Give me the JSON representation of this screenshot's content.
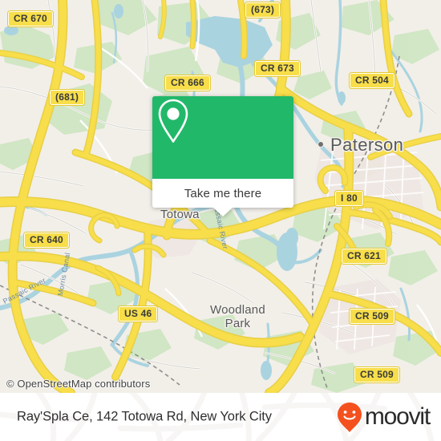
{
  "map": {
    "provider_attribution": "© OpenStreetMap contributors",
    "base_color": "#f2efe9",
    "road_color": "#f7de4a",
    "water_color": "#aad3e0",
    "park_color": "#cfe3bd",
    "city_labels": [
      {
        "name": "Paterson",
        "has_dot": true
      },
      {
        "name": "Totowa",
        "has_dot": false
      },
      {
        "name": "Woodland Park",
        "line1": "Woodland",
        "line2": "Park",
        "has_dot": false
      }
    ],
    "water_labels": [
      {
        "name": "Passaic River"
      },
      {
        "name": "Passaic River"
      },
      {
        "name": "Morris Canal"
      }
    ],
    "route_shields": [
      {
        "label": "CR 670"
      },
      {
        "label": "(673)"
      },
      {
        "label": "CR 673"
      },
      {
        "label": "CR 666"
      },
      {
        "label": "CR 504"
      },
      {
        "label": "(681)"
      },
      {
        "label": "I 80"
      },
      {
        "label": "CR 640"
      },
      {
        "label": "CR 621"
      },
      {
        "label": "US 46"
      },
      {
        "label": "CR 509"
      },
      {
        "label": "CR 509"
      }
    ]
  },
  "card": {
    "action_label": "Take me there",
    "pin_icon": "location-pin-icon",
    "accent_color": "#22b86a"
  },
  "footer": {
    "address": "Ray'Spla Ce, 142 Totowa Rd, New York City",
    "brand": "moovit",
    "brand_icon": "moovit-pin-smile-icon",
    "brand_color": "#ff5722"
  }
}
